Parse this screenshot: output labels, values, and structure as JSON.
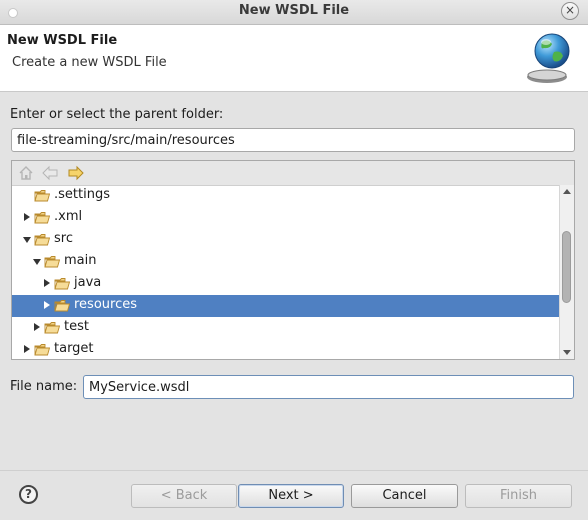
{
  "window": {
    "title": "New WSDL File",
    "close_glyph": "×"
  },
  "banner": {
    "heading": "New WSDL File",
    "description": "Create a new WSDL File",
    "icon": "globe-wizard-icon"
  },
  "parent_folder": {
    "label": "Enter or select the parent folder:",
    "value": "file-streaming/src/main/resources"
  },
  "tree_toolbar": {
    "icons": [
      "home-icon",
      "back-arrow-icon",
      "forward-arrow-icon"
    ]
  },
  "tree": {
    "items": [
      {
        "name": ".settings",
        "level": 1,
        "expander": "none",
        "open": false,
        "selected": false
      },
      {
        "name": ".xml",
        "level": 1,
        "expander": "closed",
        "open": false,
        "selected": false
      },
      {
        "name": "src",
        "level": 1,
        "expander": "open",
        "open": true,
        "selected": false
      },
      {
        "name": "main",
        "level": 2,
        "expander": "open",
        "open": true,
        "selected": false
      },
      {
        "name": "java",
        "level": 3,
        "expander": "closed",
        "open": false,
        "selected": false
      },
      {
        "name": "resources",
        "level": 3,
        "expander": "closed",
        "open": true,
        "selected": true
      },
      {
        "name": "test",
        "level": 2,
        "expander": "closed",
        "open": false,
        "selected": false
      },
      {
        "name": "target",
        "level": 1,
        "expander": "closed",
        "open": false,
        "selected": false
      }
    ]
  },
  "file_name": {
    "label": "File name:",
    "value": "MyService.wsdl"
  },
  "buttons": {
    "help": "?",
    "back": "< Back",
    "next": "Next >",
    "cancel": "Cancel",
    "finish": "Finish"
  },
  "colors": {
    "selection": "#4f80c2",
    "folder_fill": "#f4d58a",
    "folder_stroke": "#b98a2c"
  }
}
